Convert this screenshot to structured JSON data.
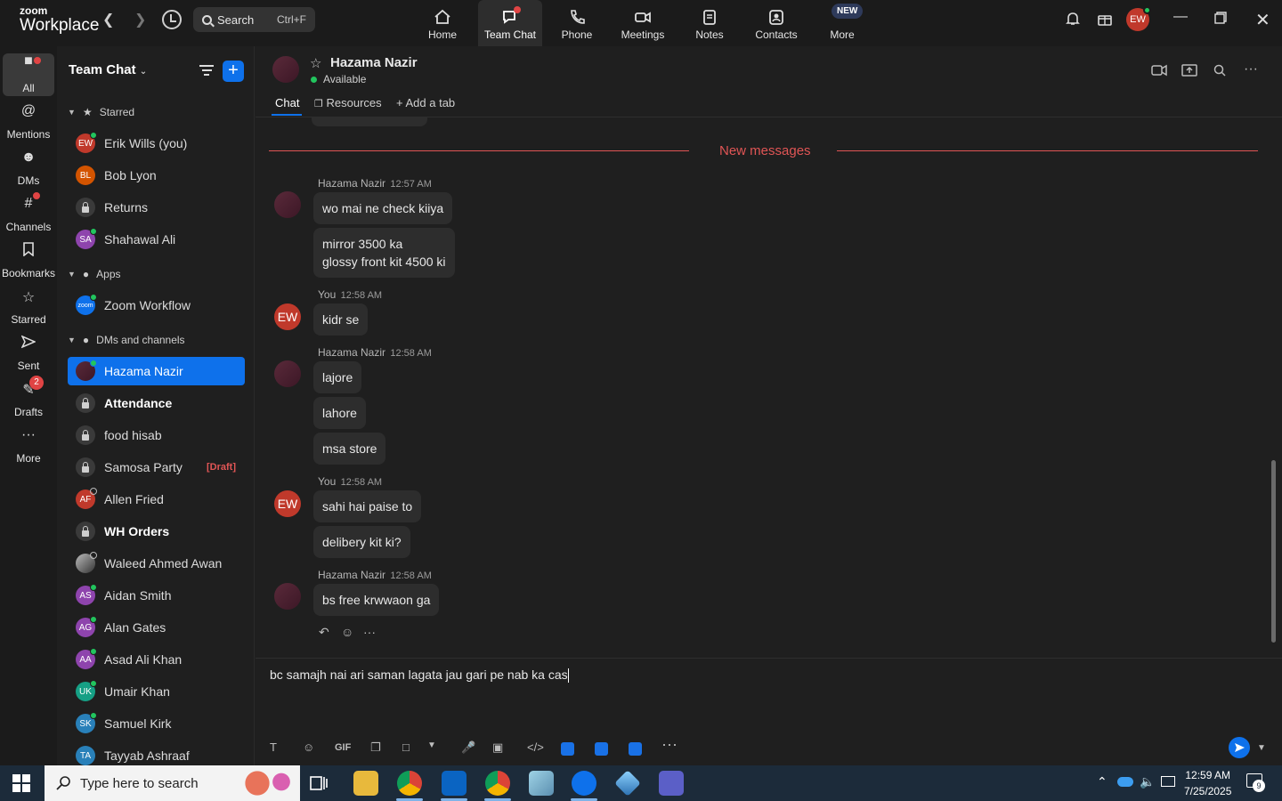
{
  "app": {
    "brand_top": "zoom",
    "brand_bottom": "Workplace"
  },
  "topbar": {
    "search_label": "Search",
    "search_shortcut": "Ctrl+F",
    "tabs": [
      {
        "label": "Home",
        "icon": "home-icon"
      },
      {
        "label": "Team Chat",
        "icon": "chat-icon"
      },
      {
        "label": "Phone",
        "icon": "phone-icon"
      },
      {
        "label": "Meetings",
        "icon": "video-icon"
      },
      {
        "label": "Notes",
        "icon": "notes-icon"
      },
      {
        "label": "Contacts",
        "icon": "contacts-icon"
      },
      {
        "label": "More",
        "icon": "more-icon"
      }
    ],
    "new_badge": "NEW",
    "user_initials": "EW"
  },
  "rail": {
    "items": [
      {
        "label": "All"
      },
      {
        "label": "Mentions"
      },
      {
        "label": "DMs"
      },
      {
        "label": "Channels"
      },
      {
        "label": "Bookmarks"
      },
      {
        "label": "Starred"
      },
      {
        "label": "Sent"
      },
      {
        "label": "Drafts"
      },
      {
        "label": "More"
      }
    ],
    "drafts_badge": "2"
  },
  "list": {
    "title": "Team Chat",
    "sections": {
      "starred": "Starred",
      "apps": "Apps",
      "dms": "DMs and channels"
    },
    "starred": [
      {
        "initials": "EW",
        "name": "Erik Wills (you)",
        "color": "#c0392b"
      },
      {
        "initials": "BL",
        "name": "Bob Lyon",
        "color": "#d35400"
      },
      {
        "initials": "",
        "name": "Returns"
      },
      {
        "initials": "SA",
        "name": "Shahawal Ali",
        "color": "#8e44ad"
      }
    ],
    "apps": [
      {
        "initials": "zoom",
        "name": "Zoom Workflow",
        "color": "#0e71eb"
      }
    ],
    "dms": [
      {
        "initials": "",
        "name": "Hazama Nazir"
      },
      {
        "initials": "",
        "name": "Attendance"
      },
      {
        "initials": "",
        "name": "food hisab"
      },
      {
        "initials": "",
        "name": "Samosa Party",
        "draft": "[Draft]"
      },
      {
        "initials": "AF",
        "name": "Allen Fried",
        "color": "#c0392b"
      },
      {
        "initials": "",
        "name": "WH Orders"
      },
      {
        "initials": "",
        "name": "Waleed Ahmed Awan"
      },
      {
        "initials": "AS",
        "name": "Aidan Smith",
        "color": "#8e44ad"
      },
      {
        "initials": "AG",
        "name": "Alan Gates",
        "color": "#8e44ad"
      },
      {
        "initials": "AA",
        "name": "Asad Ali Khan",
        "color": "#8e44ad"
      },
      {
        "initials": "UK",
        "name": "Umair Khan",
        "color": "#16a085"
      },
      {
        "initials": "SK",
        "name": "Samuel Kirk",
        "color": "#2980b9"
      },
      {
        "initials": "TA",
        "name": "Tayyab Ashraaf",
        "color": "#2980b9"
      }
    ]
  },
  "chat": {
    "name": "Hazama Nazir",
    "status": "Available",
    "tabs": {
      "chat": "Chat",
      "resources": "Resources",
      "add": "Add a tab"
    },
    "new_messages": "New messages",
    "messages": [
      {
        "sender": "Hazama Nazir",
        "time": "12:57 AM"
      },
      {
        "text": "wo mai ne check kiiya"
      },
      {
        "text": "mirror 3500 ka\nglossy front kit 4500 ki"
      },
      {
        "sender": "You",
        "time": "12:58 AM"
      },
      {
        "text": "kidr se"
      },
      {
        "sender": "Hazama Nazir",
        "time": "12:58 AM"
      },
      {
        "text": "lajore"
      },
      {
        "text": "lahore"
      },
      {
        "text": "msa store"
      },
      {
        "sender": "You",
        "time": "12:58 AM"
      },
      {
        "text": "sahi hai paise to"
      },
      {
        "text": "delibery kit ki?"
      },
      {
        "sender": "Hazama Nazir",
        "time": "12:58 AM"
      },
      {
        "text": "bs free krwwaon ga"
      }
    ],
    "me_initials": "EW",
    "composer_text": "bc samajh nai ari saman lagata jau gari pe nab ka cas",
    "toolbar_gif": "GIF"
  },
  "taskbar": {
    "search_placeholder": "Type here to search",
    "time": "12:59 AM",
    "date": "7/25/2025",
    "notif_count": "9"
  }
}
